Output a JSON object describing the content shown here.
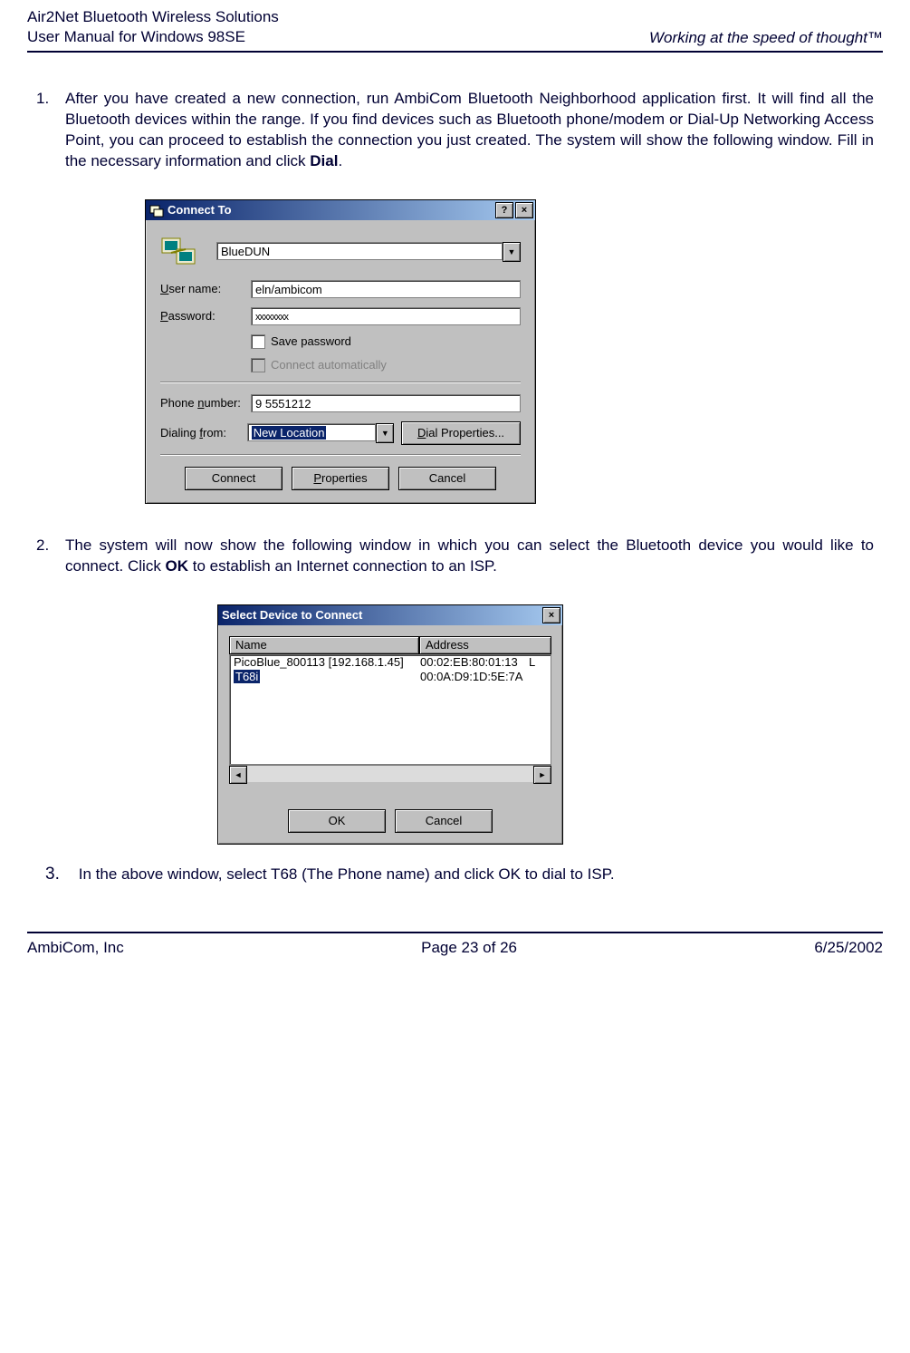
{
  "header": {
    "line1": "Air2Net Bluetooth Wireless Solutions",
    "line2": "User Manual for Windows 98SE",
    "tagline": "Working at the speed of thought™"
  },
  "step1": {
    "num": "1.",
    "text_before_bold": "After you have created a new connection, run AmbiCom Bluetooth Neighborhood application first. It will find all the Bluetooth devices within the range. If you find devices such as Bluetooth phone/modem or Dial-Up Networking Access Point, you can proceed to establish the connection you just created. The system will show the following window.  Fill in the necessary information and click ",
    "bold": "Dial",
    "text_after_bold": "."
  },
  "dlg1": {
    "title": "Connect To",
    "help": "?",
    "close": "×",
    "conn_name": "BlueDUN",
    "user_label_pre": "U",
    "user_label_post": "ser name:",
    "user_value": "eln/ambicom",
    "pass_label_pre": "P",
    "pass_label_post": "assword:",
    "pass_value": "xxxxxxxx",
    "save_pre": "S",
    "save_post": "ave password",
    "auto_pre": "Connect ",
    "auto_u": "a",
    "auto_post": "utomatically",
    "phone_label_pre": "Phone ",
    "phone_u": "n",
    "phone_post": "umber:",
    "phone_value": "9 5551212",
    "dialfrom_label_pre": "Dialing ",
    "dialfrom_u": "f",
    "dialfrom_post": "rom:",
    "dialfrom_value": "New Location",
    "dialprops_pre": "D",
    "dialprops_post": "ial Properties...",
    "btn_connect": "Connect",
    "btn_props_pre": "P",
    "btn_props_post": "roperties",
    "btn_cancel": "Cancel"
  },
  "step2": {
    "num": "2.",
    "text_before_bold": "The system will now show the following window in which you can select the Bluetooth device you would like to connect.  Click ",
    "bold": "OK",
    "text_after_bold": " to establish an Internet connection to an ISP."
  },
  "dlg2": {
    "title": "Select Device to Connect",
    "close": "×",
    "col_name": "Name",
    "col_addr": "Address",
    "rows": [
      {
        "name": "PicoBlue_800113 [192.168.1.45]",
        "addr": "00:02:EB:80:01:13",
        "tail": "L"
      },
      {
        "name": "T68i",
        "addr": "00:0A:D9:1D:5E:7A",
        "tail": ""
      }
    ],
    "btn_ok": "OK",
    "btn_cancel": "Cancel",
    "left": "◄",
    "right": "►"
  },
  "step3": {
    "num": "3.",
    "text": "In the above window, select T68 (The Phone name) and click OK to dial to ISP."
  },
  "footer": {
    "left": "AmbiCom, Inc",
    "center": "Page 23 of 26",
    "right": "6/25/2002"
  }
}
